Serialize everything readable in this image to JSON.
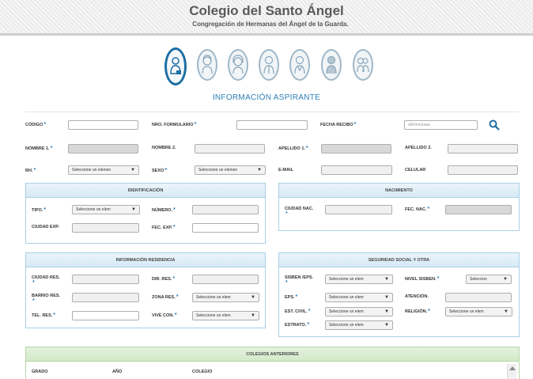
{
  "header": {
    "title": "Colegio del Santo Ángel",
    "subtitle": "Congregación de Hermanas del Ángel de la Guarda."
  },
  "section_title": "INFORMACIÓN ASPIRANTE",
  "colors": {
    "accent": "#1c6ea4",
    "link": "#2d7fb8",
    "panel_border": "#a9d0e6",
    "panel_green": "#b5d7a6"
  },
  "form": {
    "codigo": "CÓDIGO",
    "nro_formulario": "NRO. FORMULARIO",
    "fecha_recibo": "FECHA RECIBO",
    "fecha_recibo_placeholder": "dd/mm/aaaa",
    "nombre1": "NOMBRE 1.",
    "nombre2": "NOMBRE 2.",
    "apellido1": "APELLIDO 1.",
    "apellido2": "APELLIDO 2.",
    "rh": "RH.",
    "rh_select": "Seleccione un elemen",
    "sexo": "SEXO",
    "sexo_select": "Seleccione un elemen",
    "email": "E-MAIL",
    "celular": "CELULAR"
  },
  "identificacion": {
    "header": "IDENTIFICACIÓN",
    "tipo": "TIPO.",
    "tipo_select": "Seleccione un elem",
    "numero": "NÚMERO.",
    "ciudad_exp": "CIUDAD EXP.",
    "fec_exp": "FEC. EXP."
  },
  "nacimiento": {
    "header": "NACIMIENTO",
    "ciudad_nac": "CIUDAD NAC.",
    "fec_nac": "FEC. NAC."
  },
  "residencia": {
    "header": "INFORMACIÓN RESIDENCIA",
    "ciudad_res": "CIUDAD RES.",
    "dir_res": "DIR. RES.",
    "barrio_res": "BARRIO RES.",
    "zona_res": "ZONA RES.",
    "zona_select": "Seleccione un elem",
    "tel_res": "TEL. RES.",
    "vive_con": "VIVE CON.",
    "vive_select": "Seleccione un elem"
  },
  "seguridad": {
    "header": "SEGURIDAD SOCIAL Y OTRA",
    "sisben_eps": "SISBEN /EPS.",
    "sisben_select": "Seleccione un elem",
    "nivel_sisben": "NIVEL SISBEN.",
    "nivel_select": "Seleccion",
    "eps": "EPS.",
    "eps_select": "Seleccione un elem",
    "atencion": "ATENCIÓN.",
    "est_civil": "EST. CIVIL.",
    "est_civil_select": "Seleccione un elem",
    "religion": "RELIGIÓN.",
    "religion_select": "Seleccione un elem",
    "estrato": "ESTRATO.",
    "estrato_select": "Seleccione un elem"
  },
  "colegios": {
    "header": "COLEGIOS ANTERIORES",
    "grado": "GRADO",
    "anio": "AÑO",
    "colegio": "COLEGIO"
  },
  "steps": [
    "student-step-icon",
    "mother-step-icon",
    "woman-step-icon",
    "father-step-icon",
    "guardian-step-icon",
    "man-step-icon",
    "family-step-icon"
  ]
}
